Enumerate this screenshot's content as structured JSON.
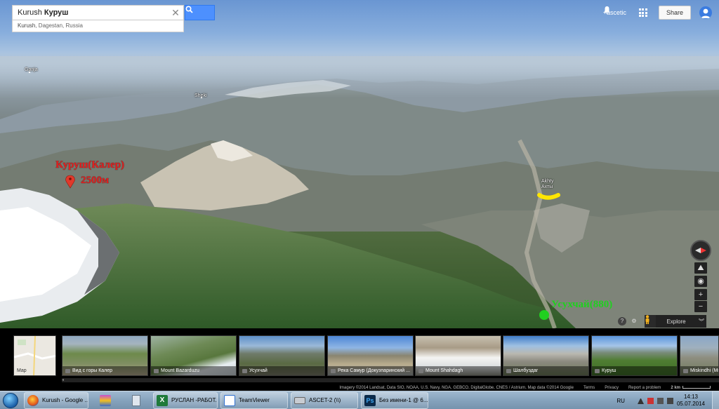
{
  "search": {
    "query_prefix": "Kurush ",
    "query_bold": "Куруш",
    "suggestion_bold": "Kurush",
    "suggestion_rest": ", Dagestan, Russia"
  },
  "topbar": {
    "user": "+ascetic",
    "share_label": "Share"
  },
  "places": {
    "ganja": "Ganja",
    "sheki": "Sheki",
    "akhty_line1": "Akhty",
    "akhty_line2": "Ахты"
  },
  "annotations": {
    "peak_name": "Куруш(Калер)",
    "peak_height": "2500м",
    "station": "Усухчай(880)"
  },
  "controls": {
    "explore_label": "Explore"
  },
  "thumbnails": [
    {
      "caption": "Map",
      "kind": "map"
    },
    {
      "caption": "Вид с горы Калер",
      "kind": "photo"
    },
    {
      "caption": "Mount Bazarduzu",
      "kind": "photo"
    },
    {
      "caption": "Усухчай",
      "kind": "photo"
    },
    {
      "caption": "Река Самур (Докузпаринский ...",
      "kind": "photo"
    },
    {
      "caption": "Mount Shahdagh",
      "kind": "photo"
    },
    {
      "caption": "Шалбуздаг",
      "kind": "photo"
    },
    {
      "caption": "Куруш",
      "kind": "photo"
    },
    {
      "caption": "Miskindhi (Мискинджи)",
      "kind": "photo"
    }
  ],
  "attribution": {
    "imagery": "Imagery ©2014 Landsat, Data SIO, NOAA, U.S. Navy, NGA, GEBCO, DigitalGlobe, CNES / Astrium, Map data ©2014 Google",
    "terms": "Terms",
    "privacy": "Privacy",
    "report": "Report a problem",
    "scale": "2 km"
  },
  "taskbar": {
    "items": [
      "Kurush - Google ...",
      "РУСЛАН -РАБОТ...",
      "TeamViewer",
      "ASCET-2 (\\\\)",
      "Без имени-1 @ 6..."
    ],
    "lang": "RU",
    "time": "14:13",
    "date": "05.07.2014"
  },
  "colors": {
    "search_blue": "#4d90fe",
    "annotation_red": "#e02020",
    "annotation_green": "#20d020",
    "highlight_yellow": "#ffe600"
  }
}
